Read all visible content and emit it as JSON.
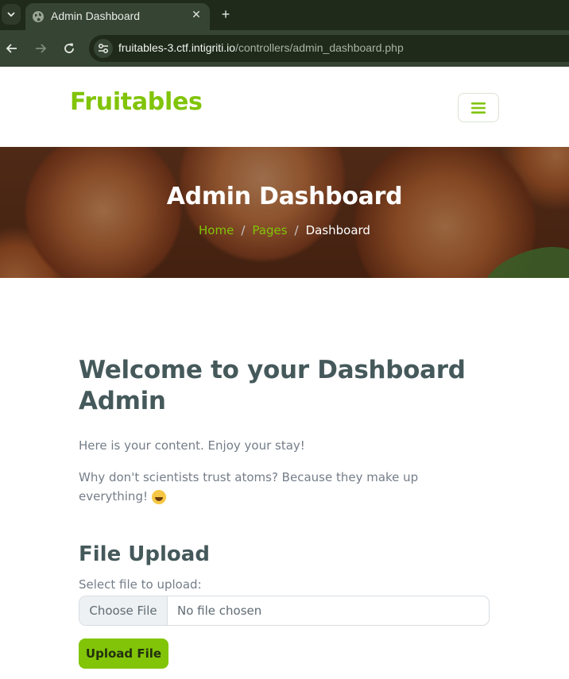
{
  "browser": {
    "tab_title": "Admin Dashboard",
    "new_tab_label": "+",
    "url_host": "fruitables-3.ctf.intigriti.io",
    "url_path": "/controllers/admin_dashboard.php"
  },
  "navbar": {
    "brand": "Fruitables"
  },
  "hero": {
    "title": "Admin Dashboard",
    "breadcrumb": {
      "home": "Home",
      "pages": "Pages",
      "current": "Dashboard",
      "separator": "/"
    }
  },
  "main": {
    "welcome_heading": "Welcome to your Dashboard Admin",
    "paragraph_1": "Here is your content. Enjoy your stay!",
    "paragraph_2": "Why don't scientists trust atoms? Because they make up everything!",
    "paragraph_2_emoji": "laughing-face-emoji",
    "upload": {
      "title": "File Upload",
      "label": "Select file to upload:",
      "choose_button": "Choose File",
      "file_status": "No file chosen",
      "submit_button": "Upload File"
    }
  },
  "colors": {
    "brand_green": "#81c408",
    "heading": "#45595b",
    "body_text": "#747d88",
    "chrome_dark": "#1f2a1b",
    "chrome_mid": "#364433"
  }
}
